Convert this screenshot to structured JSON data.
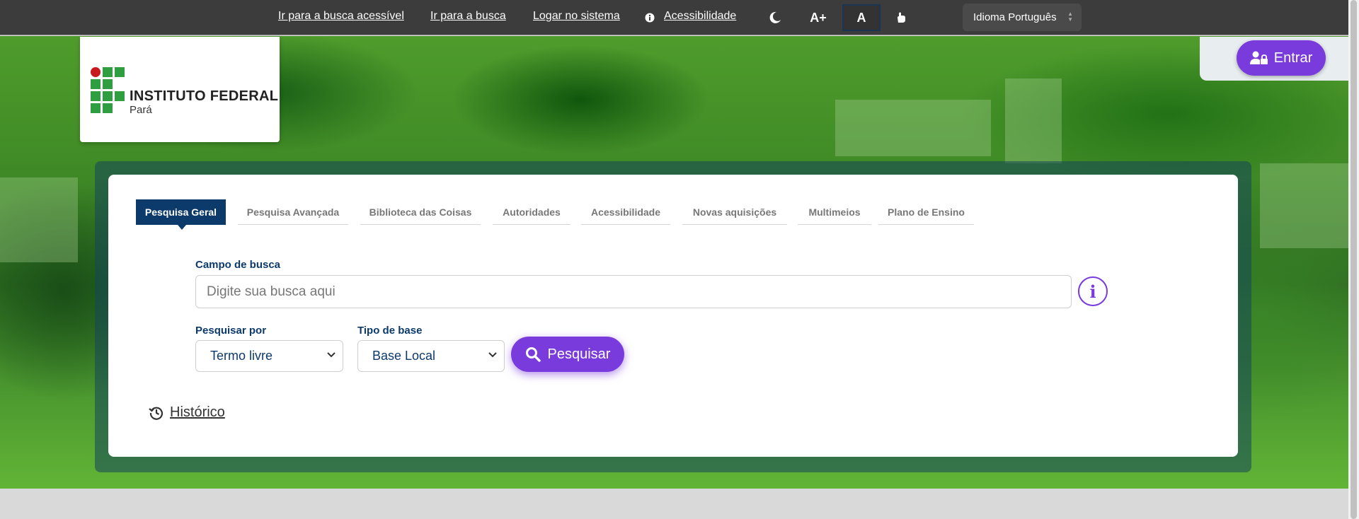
{
  "topbar": {
    "links": {
      "busca_acessivel": "Ir para a busca acessível",
      "busca": "Ir para a busca",
      "logar": "Logar no sistema",
      "acessibilidade": "Acessibilidade"
    },
    "icons": {
      "accessibility": "info-circle-icon",
      "contrast": "moon-icon",
      "font_increase": "A+",
      "font_normal": "A",
      "libras": "hand-icon"
    },
    "language": "Idioma Português"
  },
  "header": {
    "logo": {
      "name": "INSTITUTO FEDERAL",
      "subtitle": "Pará"
    },
    "login_label": "Entrar"
  },
  "tabs": [
    {
      "label": "Pesquisa Geral",
      "active": true
    },
    {
      "label": "Pesquisa Avançada",
      "active": false
    },
    {
      "label": "Biblioteca das Coisas",
      "active": false
    },
    {
      "label": "Autoridades",
      "active": false
    },
    {
      "label": "Acessibilidade",
      "active": false
    },
    {
      "label": "Novas aquisições",
      "active": false
    },
    {
      "label": "Multimeios",
      "active": false
    },
    {
      "label": "Plano de Ensino",
      "active": false
    }
  ],
  "search": {
    "label": "Campo de busca",
    "placeholder": "Digite sua busca aqui",
    "value": "",
    "pesquisar_por_label": "Pesquisar por",
    "pesquisar_por_value": "Termo livre",
    "tipo_base_label": "Tipo de base",
    "tipo_base_value": "Base Local",
    "submit_label": "Pesquisar"
  },
  "historico_label": "Histórico",
  "colors": {
    "accent": "#7a3bdc",
    "navy": "#0c3a6b",
    "brand_green": "#2f9e41",
    "brand_red": "#c8191e"
  }
}
